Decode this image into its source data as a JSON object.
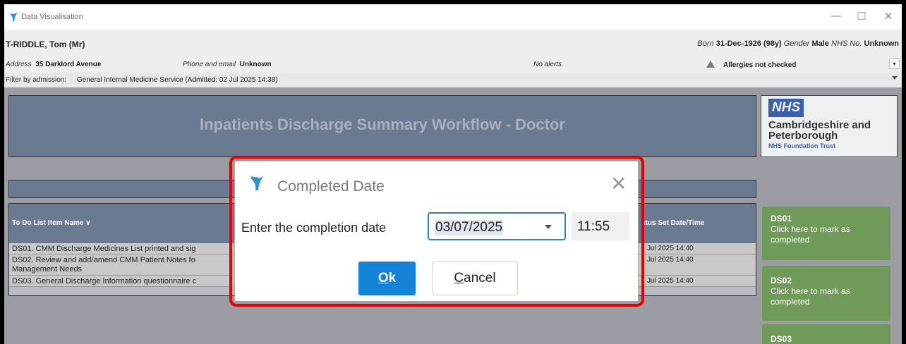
{
  "window": {
    "title": "Data Visualisation",
    "controls": {
      "minimize": "—",
      "maximize": "☐",
      "close": "✕"
    }
  },
  "patient": {
    "name": "T-RIDDLE, Tom (Mr)",
    "born_label": "Born",
    "born_value": "31-Dec-1926 (98y)",
    "gender_label": "Gender",
    "gender_value": "Male",
    "nhs_label": "NHS No.",
    "nhs_value": "Unknown",
    "address_label": "Address",
    "address_value": "35 Darklord Avenue",
    "phone_label": "Phone and email",
    "phone_value": "Unknown",
    "alerts": "No alerts",
    "allergies": "Allergies not checked",
    "toggle_icon": "▾"
  },
  "filter": {
    "label": "Filter by admission:",
    "value": "General Internal Medicine Service (Admitted: 02 Jul 2025 14:38)"
  },
  "page": {
    "heading": "Inpatients Discharge Summary Workflow  -  Doctor"
  },
  "nhs": {
    "logo": "NHS",
    "org_line1": "Cambridgeshire and",
    "org_line2": "Peterborough",
    "trust": "NHS Foundation Trust"
  },
  "todo_list": {
    "col_name": "To Do List Item Name ∨",
    "col_date": "atus Set Date/Time",
    "rows": [
      {
        "name": "DS01. CMM Discharge Medicines List printed and sig",
        "date": "Jul 2025 14:40"
      },
      {
        "name": "DS02. Review and add/amend CMM Patient Notes fo",
        "name2": "Management Needs",
        "date": "Jul 2025 14:40"
      },
      {
        "name": "DS03. General Discharge Information questionnaire c",
        "date": "Jul 2025 14:40"
      }
    ]
  },
  "cards": [
    {
      "id": "DS01",
      "text": "Click here to mark as completed"
    },
    {
      "id": "DS02",
      "text": "Click here to mark as completed"
    },
    {
      "id": "DS03",
      "text": ""
    }
  ],
  "dialog": {
    "title": "Completed Date",
    "close": "✕",
    "prompt": "Enter the completion date",
    "date_value": "03/07/2025",
    "time_value": "11:55",
    "ok_accel": "O",
    "ok_rest": "k",
    "cancel_accel": "C",
    "cancel_rest": "ancel"
  },
  "colors": {
    "accent_blue": "#1283d6",
    "highlight_red": "#e60000",
    "card_green": "#6f9a5a",
    "panel_slate": "#6a7a90",
    "nhs_blue": "#3b5fa8"
  }
}
